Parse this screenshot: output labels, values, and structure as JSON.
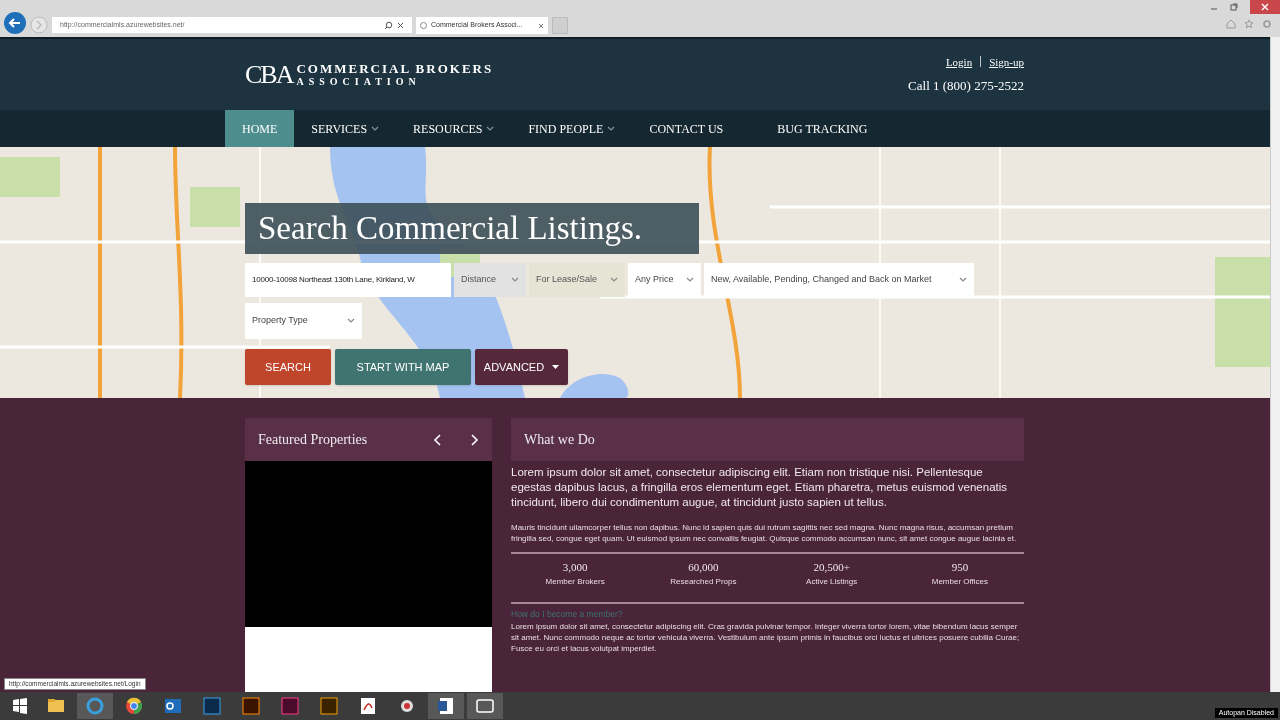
{
  "browser": {
    "address": "http://commercialmls.azurewebsites.net/",
    "tab_title": "Commercial Brokers Associ...",
    "status_url": "http://commercialmls.azurewebsites.net/Login"
  },
  "header": {
    "logo_mark": "CBA",
    "logo_title": "COMMERCIAL BROKERS",
    "logo_subtitle": "ASSOCIATION",
    "links": [
      "Login",
      "Sign-up"
    ],
    "phone": "Call 1 (800) 275-2522"
  },
  "nav": [
    {
      "label": "HOME",
      "selected": true,
      "dropdown": false
    },
    {
      "label": "SERVICES",
      "selected": false,
      "dropdown": true
    },
    {
      "label": "RESOURCES",
      "selected": false,
      "dropdown": true
    },
    {
      "label": "FIND PEOPLE",
      "selected": false,
      "dropdown": true
    },
    {
      "label": "CONTACT US",
      "selected": false,
      "dropdown": false
    },
    {
      "label": "BUG TRACKING",
      "selected": false,
      "dropdown": false
    }
  ],
  "search": {
    "heading": "Search Commercial Listings.",
    "fields": [
      {
        "kind": "text",
        "value": "10000-10098 Northeast 130th Lane, Kirkland, W"
      },
      {
        "kind": "shaded",
        "value": "Distance"
      },
      {
        "kind": "tinted",
        "value": "For Lease/Sale"
      },
      {
        "kind": "select",
        "value": "Any Price"
      },
      {
        "kind": "select",
        "value": "New, Available, Pending, Changed and Back on Market"
      },
      {
        "kind": "select",
        "value": "Property Type"
      }
    ],
    "buttons": [
      {
        "kind": "search",
        "label": "SEARCH"
      },
      {
        "kind": "map",
        "label": "START WITH MAP"
      },
      {
        "kind": "advanced",
        "label": "ADVANCED"
      }
    ]
  },
  "featured": {
    "title": "Featured Properties"
  },
  "about": {
    "title": "What we Do",
    "lead": "Lorem ipsum dolor sit amet, consectetur adipiscing elit. Etiam non tristique nisi. Pellentesque egestas dapibus lacus, a fringilla eros elementum eget. Etiam pharetra, metus euismod venenatis tincidunt, libero dui condimentum augue, at tincidunt justo sapien ut tellus.",
    "body": "Mauris tincidunt ullamcorper tellus non dapibus. Nunc id sapien quis dui rutrum sagittis nec sed magna. Nunc magna risus, accumsan pretium fringilla sed, congue eget quam. Ut euismod ipsum nec convallis feugiat. Quisque commodo accumsan nunc, sit amet congue augue lacinia et.",
    "stats": [
      {
        "value": "3,000",
        "label": "Member Brokers"
      },
      {
        "value": "60,000",
        "label": "Researched Props"
      },
      {
        "value": "20,500+",
        "label": "Active Listings"
      },
      {
        "value": "950",
        "label": "Member Offices"
      }
    ],
    "question": "How do I become a member?",
    "answer": "Lorem ipsum dolor sit amet, consectetur adipiscing elit. Cras gravida pulvinar tempor. Integer viverra tortor lorem, vitae bibendum lacus semper sit amet. Nunc commodo neque ac tortor vehicula viverra. Vestibulum ante ipsum primis in faucibus orci luctus et ultrices posuere cubilia Curae; Fusce eu orci et lacus volutpat imperdiet."
  },
  "taskbar": {
    "status": "Autopan Disabled"
  }
}
